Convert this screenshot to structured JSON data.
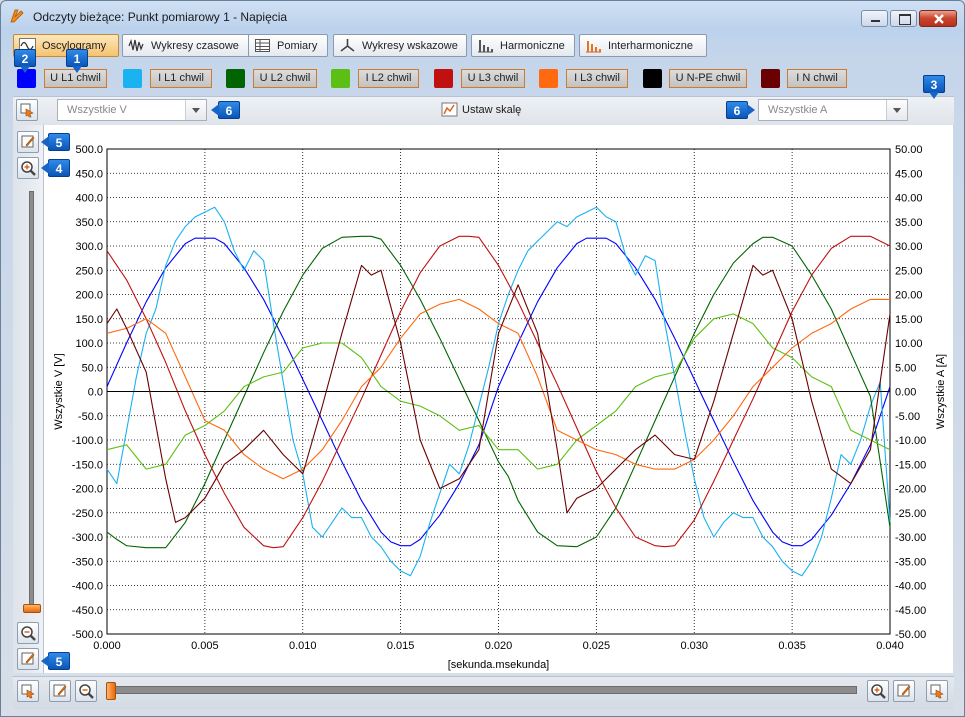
{
  "window": {
    "title": "Odczyty bieżące: Punkt pomiarowy 1 - Napięcia"
  },
  "tabs": [
    {
      "label": "Oscylogramy",
      "active": true,
      "icon": "oscillogram-icon"
    },
    {
      "label": "Wykresy czasowe",
      "active": false,
      "icon": "time-chart-icon"
    },
    {
      "label": "Pomiary",
      "active": false,
      "icon": "table-icon"
    },
    {
      "label": "Wykresy wskazowe",
      "active": false,
      "icon": "phasor-icon"
    },
    {
      "label": "Harmoniczne",
      "active": false,
      "icon": "harmonics-icon"
    },
    {
      "label": "Interharmoniczne",
      "active": false,
      "icon": "interharmonics-icon"
    }
  ],
  "channels": [
    {
      "label": "U L1 chwil",
      "color": "#0000ff"
    },
    {
      "label": "I L1 chwil",
      "color": "#1ab2f0"
    },
    {
      "label": "U L2 chwil",
      "color": "#006400"
    },
    {
      "label": "I L2 chwil",
      "color": "#5cc014"
    },
    {
      "label": "U L3 chwil",
      "color": "#c01010"
    },
    {
      "label": "I L3 chwil",
      "color": "#ff6a10"
    },
    {
      "label": "U N-PE chwil",
      "color": "#000000"
    },
    {
      "label": "I N chwil",
      "color": "#6b0000"
    }
  ],
  "badges": {
    "b1": "1",
    "b2": "2",
    "b3": "3",
    "b4": "4",
    "b5": "5",
    "b6": "6"
  },
  "toolbar": {
    "voltage_select": "Wszystkie V",
    "current_select": "Wszystkie A",
    "scale_button": "Ustaw skalę"
  },
  "chart_data": {
    "type": "line",
    "xlabel": "[sekunda.msekunda]",
    "ylabel": "Wszystkie V [V]",
    "ylabel_right": "Wszystkie A [A]",
    "xlim": [
      0,
      0.04
    ],
    "ylim": [
      -500,
      500
    ],
    "ylim_right": [
      -50,
      50
    ],
    "x_ticks": [
      "0.000",
      "0.005",
      "0.010",
      "0.015",
      "0.020",
      "0.025",
      "0.030",
      "0.035",
      "0.040"
    ],
    "y_ticks": [
      "500.0",
      "450.0",
      "400.0",
      "350.0",
      "300.0",
      "250.0",
      "200.0",
      "150.0",
      "100.0",
      "50.0",
      "0.0",
      "-50.0",
      "-100.0",
      "-150.0",
      "-200.0",
      "-250.0",
      "-300.0",
      "-350.0",
      "-400.0",
      "-450.0",
      "-500.0"
    ],
    "y_ticks_right": [
      "50.00",
      "45.00",
      "40.00",
      "35.00",
      "30.00",
      "25.00",
      "20.00",
      "15.00",
      "10.00",
      "5.00",
      "0.00",
      "-5.00",
      "-10.00",
      "-15.00",
      "-20.00",
      "-25.00",
      "-30.00",
      "-35.00",
      "-40.00",
      "-45.00",
      "-50.00"
    ],
    "grid": true,
    "series": [
      {
        "name": "U L1 chwil",
        "color": "#0000ff",
        "axis": "left",
        "x": [
          0,
          0.001,
          0.002,
          0.003,
          0.004,
          0.0045,
          0.005,
          0.0055,
          0.006,
          0.007,
          0.008,
          0.009,
          0.01,
          0.011,
          0.012,
          0.013,
          0.014,
          0.0145,
          0.015,
          0.0155,
          0.016,
          0.017,
          0.018,
          0.019,
          0.02,
          0.021,
          0.022,
          0.023,
          0.024,
          0.0245,
          0.025,
          0.0255,
          0.026,
          0.027,
          0.028,
          0.029,
          0.03,
          0.031,
          0.032,
          0.033,
          0.034,
          0.0345,
          0.035,
          0.0355,
          0.036,
          0.037,
          0.038,
          0.039,
          0.04
        ],
        "y": [
          10,
          100,
          185,
          255,
          305,
          316,
          316,
          316,
          305,
          255,
          190,
          110,
          25,
          -60,
          -145,
          -225,
          -290,
          -310,
          -318,
          -318,
          -305,
          -255,
          -190,
          -110,
          10,
          100,
          185,
          255,
          305,
          316,
          316,
          316,
          305,
          255,
          190,
          110,
          25,
          -60,
          -145,
          -225,
          -290,
          -310,
          -318,
          -318,
          -305,
          -255,
          -190,
          -110,
          10
        ]
      },
      {
        "name": "I L1 chwil",
        "color": "#1ab2f0",
        "axis": "right",
        "x": [
          0,
          0.0005,
          0.001,
          0.0015,
          0.002,
          0.0025,
          0.003,
          0.0035,
          0.004,
          0.0045,
          0.005,
          0.0055,
          0.006,
          0.0065,
          0.007,
          0.0075,
          0.008,
          0.0085,
          0.009,
          0.0095,
          0.01,
          0.0105,
          0.011,
          0.0115,
          0.012,
          0.0125,
          0.013,
          0.0135,
          0.014,
          0.0145,
          0.015,
          0.0155,
          0.016,
          0.0165,
          0.017,
          0.0175,
          0.018,
          0.0185,
          0.019,
          0.0195,
          0.02,
          0.0205,
          0.021,
          0.0215,
          0.022,
          0.0225,
          0.023,
          0.0235,
          0.024,
          0.0245,
          0.025,
          0.0255,
          0.026,
          0.0265,
          0.027,
          0.0275,
          0.028,
          0.0285,
          0.029,
          0.0295,
          0.03,
          0.0305,
          0.031,
          0.0315,
          0.032,
          0.0325,
          0.033,
          0.0335,
          0.034,
          0.0345,
          0.035,
          0.0355,
          0.036,
          0.0365,
          0.037,
          0.0375,
          0.038,
          0.0385,
          0.039,
          0.0395,
          0.04
        ],
        "y": [
          -16,
          -19,
          -8,
          3,
          12,
          17,
          26,
          31,
          34,
          36,
          37,
          38,
          35,
          29,
          25,
          29,
          27,
          14,
          2,
          -10,
          -17,
          -28,
          -30,
          -27,
          -24,
          -26,
          -26,
          -30,
          -32,
          -35,
          -37,
          -38,
          -34,
          -27,
          -21,
          -15,
          -17,
          -11,
          -3,
          5,
          14,
          20,
          25,
          29,
          31,
          33,
          35,
          34,
          36,
          37,
          38,
          36,
          35,
          28,
          24,
          28,
          27,
          14,
          3,
          -8,
          -18,
          -26,
          -30,
          -27,
          -25,
          -26,
          -26,
          -30,
          -32,
          -35,
          -37,
          -38,
          -35,
          -30,
          -22,
          -13,
          -15,
          -10,
          -3,
          2,
          -27
        ]
      },
      {
        "name": "U L2 chwil",
        "color": "#006400",
        "axis": "left",
        "x": [
          0,
          0.0005,
          0.001,
          0.002,
          0.003,
          0.004,
          0.005,
          0.006,
          0.007,
          0.008,
          0.009,
          0.01,
          0.011,
          0.012,
          0.013,
          0.0135,
          0.014,
          0.015,
          0.016,
          0.017,
          0.018,
          0.019,
          0.02,
          0.0205,
          0.021,
          0.022,
          0.023,
          0.024,
          0.025,
          0.026,
          0.027,
          0.028,
          0.029,
          0.03,
          0.031,
          0.032,
          0.033,
          0.0335,
          0.034,
          0.035,
          0.036,
          0.037,
          0.038,
          0.039,
          0.04
        ],
        "y": [
          -290,
          -305,
          -318,
          -322,
          -322,
          -270,
          -190,
          -100,
          -10,
          80,
          165,
          240,
          295,
          318,
          320,
          320,
          314,
          260,
          190,
          110,
          25,
          -60,
          -145,
          -175,
          -225,
          -290,
          -318,
          -320,
          -300,
          -240,
          -150,
          -60,
          30,
          120,
          200,
          265,
          305,
          318,
          318,
          300,
          240,
          170,
          80,
          -10,
          -280
        ]
      },
      {
        "name": "I L2 chwil",
        "color": "#5cc014",
        "axis": "right",
        "x": [
          0,
          0.001,
          0.002,
          0.003,
          0.004,
          0.005,
          0.006,
          0.007,
          0.008,
          0.009,
          0.01,
          0.011,
          0.012,
          0.013,
          0.014,
          0.015,
          0.016,
          0.017,
          0.018,
          0.019,
          0.02,
          0.021,
          0.022,
          0.023,
          0.024,
          0.025,
          0.026,
          0.027,
          0.028,
          0.029,
          0.03,
          0.031,
          0.032,
          0.033,
          0.034,
          0.035,
          0.036,
          0.037,
          0.038,
          0.039,
          0.04
        ],
        "y": [
          -12,
          -11,
          -16,
          -15,
          -9,
          -7,
          -4,
          1,
          3,
          4,
          9,
          10,
          10,
          7,
          1,
          -2,
          -3,
          -5,
          -8,
          -7,
          -12,
          -12,
          -16,
          -15,
          -10,
          -7,
          -4,
          1,
          3,
          4,
          11,
          15,
          16,
          14,
          9,
          7,
          3,
          1,
          -8,
          -10,
          -12
        ]
      },
      {
        "name": "U L3 chwil",
        "color": "#c01010",
        "axis": "left",
        "x": [
          0,
          0.001,
          0.002,
          0.003,
          0.004,
          0.005,
          0.006,
          0.007,
          0.008,
          0.0085,
          0.009,
          0.01,
          0.011,
          0.012,
          0.013,
          0.014,
          0.015,
          0.016,
          0.017,
          0.018,
          0.0185,
          0.019,
          0.02,
          0.021,
          0.022,
          0.023,
          0.024,
          0.025,
          0.026,
          0.027,
          0.028,
          0.0285,
          0.029,
          0.03,
          0.031,
          0.032,
          0.033,
          0.034,
          0.035,
          0.036,
          0.037,
          0.038,
          0.0385,
          0.039,
          0.04
        ],
        "y": [
          290,
          230,
          150,
          60,
          -40,
          -130,
          -210,
          -280,
          -318,
          -322,
          -320,
          -260,
          -185,
          -100,
          -15,
          75,
          165,
          245,
          300,
          320,
          320,
          318,
          260,
          185,
          100,
          15,
          -75,
          -165,
          -240,
          -300,
          -318,
          -320,
          -318,
          -265,
          -185,
          -100,
          -15,
          75,
          165,
          240,
          295,
          320,
          320,
          320,
          300
        ]
      },
      {
        "name": "I L3 chwil",
        "color": "#ff6a10",
        "axis": "right",
        "x": [
          0,
          0.001,
          0.002,
          0.003,
          0.004,
          0.005,
          0.006,
          0.007,
          0.008,
          0.009,
          0.01,
          0.011,
          0.012,
          0.013,
          0.014,
          0.015,
          0.016,
          0.017,
          0.018,
          0.019,
          0.02,
          0.021,
          0.022,
          0.023,
          0.024,
          0.025,
          0.026,
          0.027,
          0.028,
          0.029,
          0.03,
          0.031,
          0.032,
          0.033,
          0.034,
          0.035,
          0.036,
          0.037,
          0.038,
          0.039,
          0.04
        ],
        "y": [
          12,
          13,
          15,
          12,
          3,
          -6,
          -8,
          -13,
          -16,
          -18,
          -16,
          -12,
          -6,
          1,
          5,
          11,
          16,
          18,
          19,
          17,
          14,
          12,
          3,
          -8,
          -10,
          -12,
          -13,
          -15,
          -16,
          -16,
          -14,
          -10,
          -5,
          1,
          5,
          9,
          12,
          14,
          17,
          19,
          19
        ]
      },
      {
        "name": "U N-PE chwil",
        "color": "#000000",
        "axis": "left",
        "x": [
          0,
          0.04
        ],
        "y": [
          0,
          0
        ]
      },
      {
        "name": "I N chwil",
        "color": "#6b0000",
        "axis": "right",
        "x": [
          0,
          0.0005,
          0.001,
          0.002,
          0.003,
          0.0035,
          0.004,
          0.005,
          0.006,
          0.007,
          0.008,
          0.009,
          0.01,
          0.011,
          0.012,
          0.013,
          0.0135,
          0.014,
          0.015,
          0.016,
          0.017,
          0.018,
          0.019,
          0.02,
          0.021,
          0.022,
          0.023,
          0.0235,
          0.024,
          0.025,
          0.026,
          0.027,
          0.028,
          0.029,
          0.03,
          0.031,
          0.032,
          0.033,
          0.0335,
          0.034,
          0.035,
          0.036,
          0.037,
          0.038,
          0.039,
          0.04
        ],
        "y": [
          14,
          17,
          13,
          4,
          -18,
          -27,
          -26,
          -22,
          -15,
          -12,
          -8,
          -13,
          -17,
          -3,
          12,
          26,
          24,
          25,
          10,
          -10,
          -20,
          -18,
          -12,
          12,
          22,
          12,
          -12,
          -25,
          -22,
          -20,
          -16,
          -12,
          -9,
          -13,
          -14,
          -2,
          12,
          26,
          24,
          25,
          15,
          -2,
          -16,
          -19,
          -12,
          16
        ]
      }
    ]
  }
}
